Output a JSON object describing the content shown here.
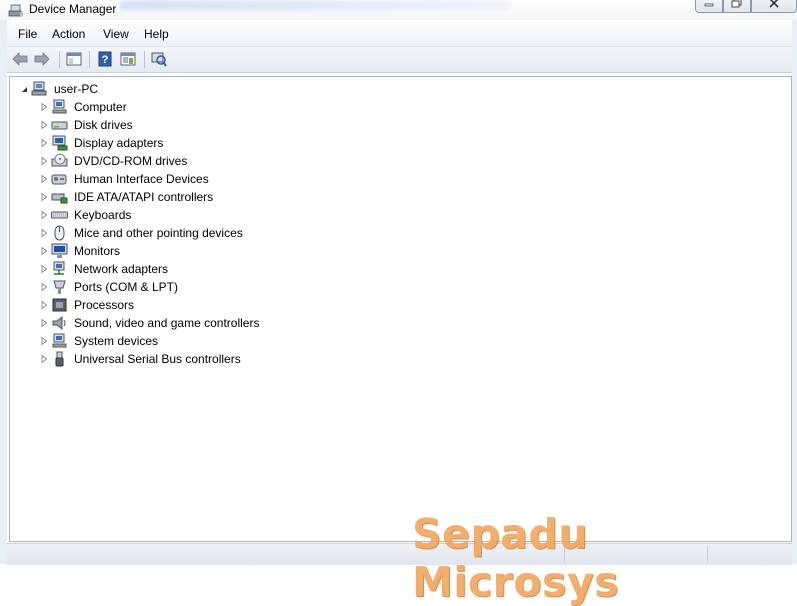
{
  "window": {
    "title": "Device Manager"
  },
  "menu": {
    "items": [
      "File",
      "Action",
      "View",
      "Help"
    ]
  },
  "toolbar": {
    "buttons": [
      "back-arrow-icon",
      "forward-arrow-icon",
      "show-hide-tree-icon",
      "help-icon",
      "properties-icon",
      "scan-hardware-icon"
    ]
  },
  "tree": {
    "root": "user-PC",
    "items": [
      {
        "label": "Computer",
        "icon": "computer-icon"
      },
      {
        "label": "Disk drives",
        "icon": "disk-drive-icon"
      },
      {
        "label": "Display adapters",
        "icon": "display-adapter-icon"
      },
      {
        "label": "DVD/CD-ROM drives",
        "icon": "dvd-drive-icon"
      },
      {
        "label": "Human Interface Devices",
        "icon": "hid-icon"
      },
      {
        "label": "IDE ATA/ATAPI controllers",
        "icon": "ide-controller-icon"
      },
      {
        "label": "Keyboards",
        "icon": "keyboard-icon"
      },
      {
        "label": "Mice and other pointing devices",
        "icon": "mouse-icon"
      },
      {
        "label": "Monitors",
        "icon": "monitor-icon"
      },
      {
        "label": "Network adapters",
        "icon": "network-adapter-icon"
      },
      {
        "label": "Ports (COM & LPT)",
        "icon": "port-icon"
      },
      {
        "label": "Processors",
        "icon": "processor-icon"
      },
      {
        "label": "Sound, video and game controllers",
        "icon": "speaker-icon"
      },
      {
        "label": "System devices",
        "icon": "system-device-icon"
      },
      {
        "label": "Universal Serial Bus controllers",
        "icon": "usb-icon"
      }
    ]
  },
  "watermark": "Sepadu Microsys"
}
